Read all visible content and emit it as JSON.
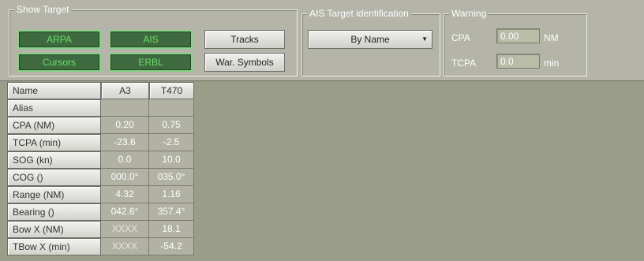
{
  "show_target": {
    "legend": "Show Target",
    "buttons": [
      "ARPA",
      "AIS",
      "Cursors",
      "ERBL"
    ],
    "tracks_label": "Tracks",
    "war_symbols_label": "War. Symbols"
  },
  "ais": {
    "legend": "AIS Target identification",
    "selected": "By Name"
  },
  "warning": {
    "legend": "Warning",
    "cpa_label": "CPA",
    "cpa_value": "0.00",
    "cpa_unit": "NM",
    "tcpa_label": "TCPA",
    "tcpa_value": "0.0",
    "tcpa_unit": "min"
  },
  "table": {
    "header": {
      "name": "Name",
      "col1": "A3",
      "col2": "T470"
    },
    "rows": [
      {
        "label": "Alias",
        "v1": "",
        "v2": ""
      },
      {
        "label": "CPA (NM)",
        "v1": "0.20",
        "v2": "0.75"
      },
      {
        "label": "TCPA (min)",
        "v1": "-23.6",
        "v2": "-2.5"
      },
      {
        "label": "SOG (kn)",
        "v1": "0.0",
        "v2": "10.0"
      },
      {
        "label": "COG ()",
        "v1": "000.0°",
        "v2": "035.0°"
      },
      {
        "label": "Range (NM)",
        "v1": "4.32",
        "v2": "1.16"
      },
      {
        "label": "Bearing ()",
        "v1": "042.6°",
        "v2": "357.4°"
      },
      {
        "label": "Bow X (NM)",
        "v1": "XXXX",
        "v2": "18.1"
      },
      {
        "label": "TBow X (min)",
        "v1": "XXXX",
        "v2": "-54.2"
      }
    ]
  }
}
